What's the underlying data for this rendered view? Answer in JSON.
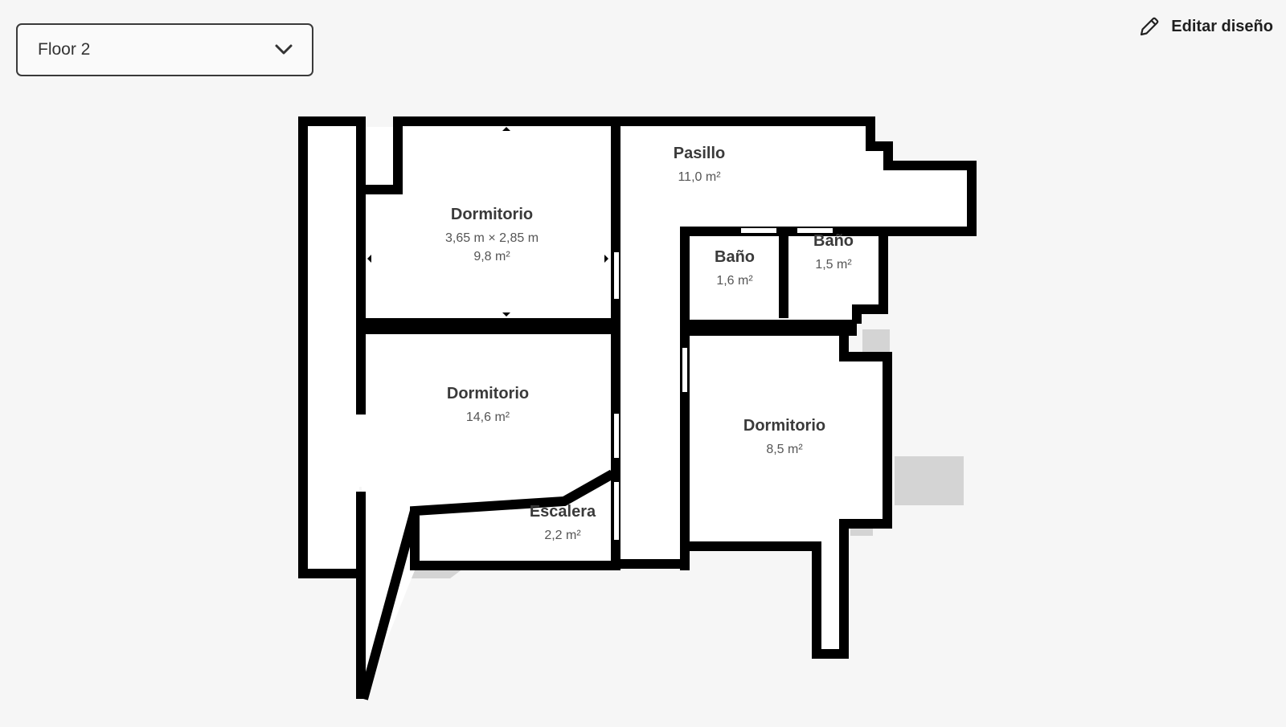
{
  "floor_selector": {
    "value": "Floor 2",
    "icon": "chevron-down-icon"
  },
  "edit_button": {
    "label": "Editar diseño",
    "icon": "pencil-icon"
  },
  "rooms": {
    "dormitorio_1": {
      "name": "Dormitorio",
      "dimensions": "3,65 m × 2,85 m",
      "area": "9,8 m²"
    },
    "pasillo": {
      "name": "Pasillo",
      "area": "11,0 m²"
    },
    "bano_1": {
      "name": "Baño",
      "area": "1,6 m²"
    },
    "bano_2": {
      "name": "Baño",
      "area": "1,5 m²"
    },
    "dormitorio_2": {
      "name": "Dormitorio",
      "area": "14,6 m²"
    },
    "dormitorio_3": {
      "name": "Dormitorio",
      "area": "8,5 m²"
    },
    "escalera": {
      "name": "Escalera",
      "area": "2,2 m²"
    }
  },
  "colors": {
    "background": "#f6f6f6",
    "wall": "#000000",
    "floor": "#ffffff",
    "shadow": "#d4d4d4"
  }
}
